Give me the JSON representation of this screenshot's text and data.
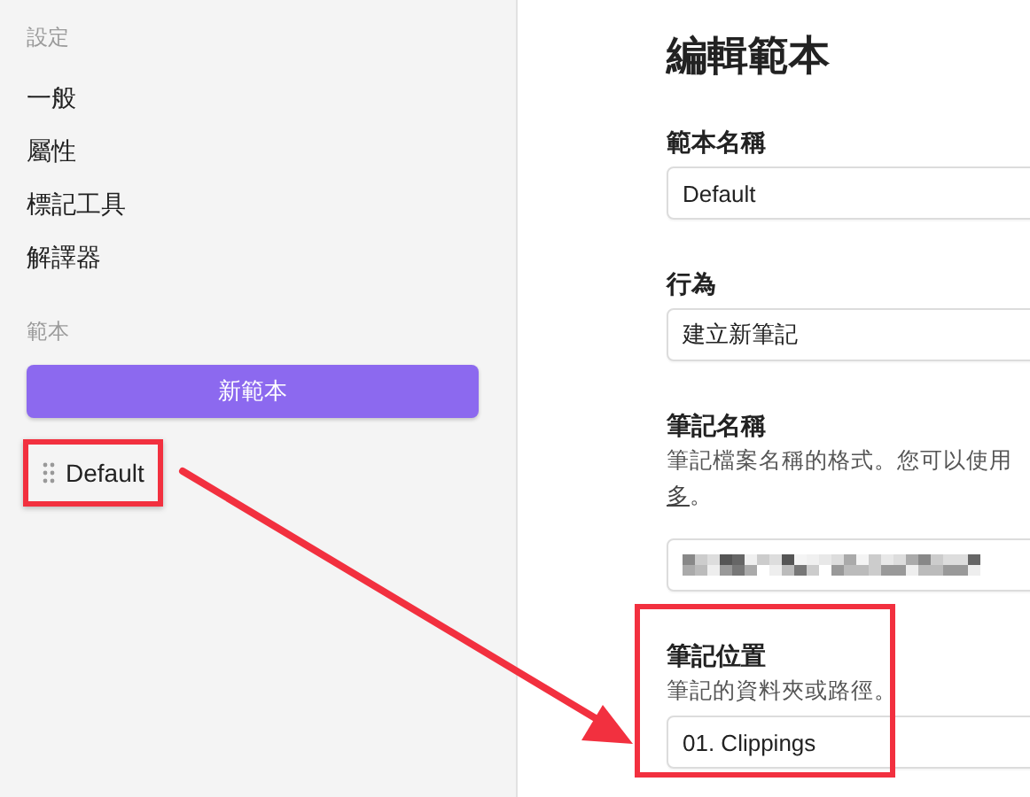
{
  "sidebar": {
    "sections": [
      {
        "heading": "設定",
        "items": [
          {
            "label": "一般"
          },
          {
            "label": "屬性"
          },
          {
            "label": "標記工具"
          },
          {
            "label": "解譯器"
          }
        ]
      },
      {
        "heading": "範本",
        "button": "新範本",
        "items": [
          {
            "label": "Default",
            "kind": "template",
            "highlighted": true
          }
        ]
      }
    ]
  },
  "editor": {
    "title": "編輯範本",
    "fields": [
      {
        "label": "範本名稱",
        "value": "Default"
      },
      {
        "label": "行為",
        "value": "建立新筆記"
      },
      {
        "label": "筆記名稱",
        "description": "筆記檔案名稱的格式。您可以使用",
        "link": "多",
        "link_suffix": "。",
        "redacted": true
      },
      {
        "label": "筆記位置",
        "description": "筆記的資料夾或路徑。",
        "value": "01. Clippings",
        "highlighted": true
      }
    ]
  },
  "annotations": [
    {
      "kind": "arrow"
    }
  ]
}
